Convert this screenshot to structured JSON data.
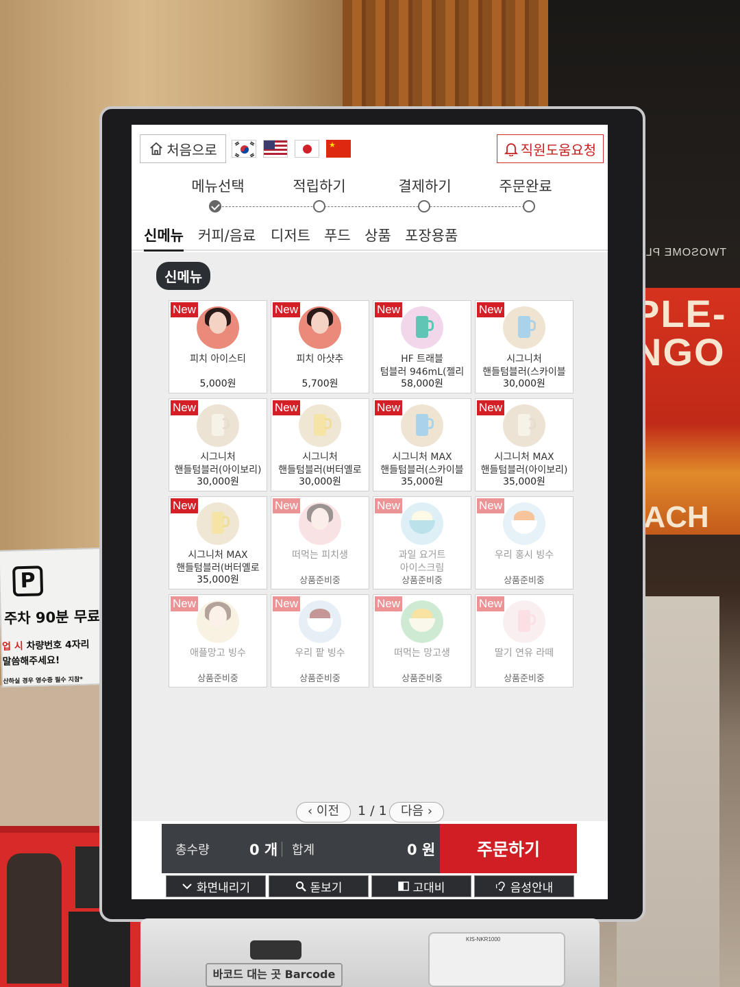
{
  "header": {
    "home_label": "처음으로",
    "staff_label": "직원도움요청"
  },
  "languages": [
    "korean",
    "english",
    "japanese",
    "chinese"
  ],
  "steps": [
    {
      "label": "메뉴선택",
      "done": true
    },
    {
      "label": "적립하기",
      "done": false
    },
    {
      "label": "결제하기",
      "done": false
    },
    {
      "label": "주문완료",
      "done": false
    }
  ],
  "categories": [
    {
      "label": "신메뉴",
      "active": true
    },
    {
      "label": "커피/음료",
      "active": false
    },
    {
      "label": "디저트",
      "active": false
    },
    {
      "label": "푸드",
      "active": false
    },
    {
      "label": "상품",
      "active": false
    },
    {
      "label": "포장용품",
      "active": false
    }
  ],
  "section_title": "신메뉴",
  "badge_label": "New",
  "products": [
    {
      "name": "피치 아이스티",
      "price": "5,000원",
      "soldout": false,
      "thumb": "portrait-red"
    },
    {
      "name": "피치 아샷추",
      "price": "5,700원",
      "soldout": false,
      "thumb": "portrait-red"
    },
    {
      "name": "HF 트래블\n텀블러 946mL(젤리",
      "price": "58,000원",
      "soldout": false,
      "thumb": "tumbler-mint"
    },
    {
      "name": "시그니처\n핸들텀블러(스카이블",
      "price": "30,000원",
      "soldout": false,
      "thumb": "mug-sky"
    },
    {
      "name": "시그니처\n핸들텀블러(아이보리)",
      "price": "30,000원",
      "soldout": false,
      "thumb": "mug-ivory"
    },
    {
      "name": "시그니처\n핸들텀블러(버터옐로",
      "price": "30,000원",
      "soldout": false,
      "thumb": "mug-yellow"
    },
    {
      "name": "시그니처 MAX\n핸들텀블러(스카이블",
      "price": "35,000원",
      "soldout": false,
      "thumb": "mug-sky"
    },
    {
      "name": "시그니처 MAX\n핸들텀블러(아이보리)",
      "price": "35,000원",
      "soldout": false,
      "thumb": "mug-ivory"
    },
    {
      "name": "시그니처 MAX\n핸들텀블러(버터옐로",
      "price": "35,000원",
      "soldout": false,
      "thumb": "mug-yellow"
    },
    {
      "name": "떠먹는 피치생",
      "price": "상품준비중",
      "soldout": true,
      "thumb": "portrait-pink"
    },
    {
      "name": "과일 요거트\n아이스크림",
      "price": "상품준비중",
      "soldout": true,
      "thumb": "bowl-blue"
    },
    {
      "name": "우리 홍시 빙수",
      "price": "상품준비중",
      "soldout": true,
      "thumb": "bowl-orange"
    },
    {
      "name": "애플망고 빙수",
      "price": "상품준비중",
      "soldout": true,
      "thumb": "portrait-yellow"
    },
    {
      "name": "우리 팥 빙수",
      "price": "상품준비중",
      "soldout": true,
      "thumb": "bowl-red"
    },
    {
      "name": "떠먹는 망고생",
      "price": "상품준비중",
      "soldout": true,
      "thumb": "cake-mango"
    },
    {
      "name": "딸기 연유 라떼",
      "price": "상품준비중",
      "soldout": true,
      "thumb": "cup-pink"
    }
  ],
  "pager": {
    "prev": "이전",
    "next": "다음",
    "page": "1 / 1"
  },
  "summary": {
    "qty_label": "총수량",
    "qty_value": "0 개",
    "total_label": "합계",
    "total_value": "0 원",
    "order_label": "주문하기"
  },
  "accessibility": [
    {
      "label": "화면내리기",
      "icon": "chevron-down-icon"
    },
    {
      "label": "돋보기",
      "icon": "magnifier-icon"
    },
    {
      "label": "고대비",
      "icon": "contrast-icon"
    },
    {
      "label": "음성안내",
      "icon": "ear-icon"
    }
  ],
  "environment": {
    "parking_line1": "주차 90분 무료",
    "parking_line2_red": "업 시",
    "parking_line2": " 차량번호 4자리",
    "parking_line3": "말씀해주세요!",
    "parking_line4": "산하실 경우 영수증 필수 지참*",
    "poster_text": "PLE-\nNGO",
    "poster_each": "EACH",
    "store_sign": "TWOSOME PLA",
    "barcode_label": "바코드 대는 곳 Barcode",
    "reader_label": "KIS-NKR1000"
  },
  "colors": {
    "accent_red": "#d11e24",
    "new_badge": "#d41f26",
    "footer_dark": "#3c3f44"
  }
}
